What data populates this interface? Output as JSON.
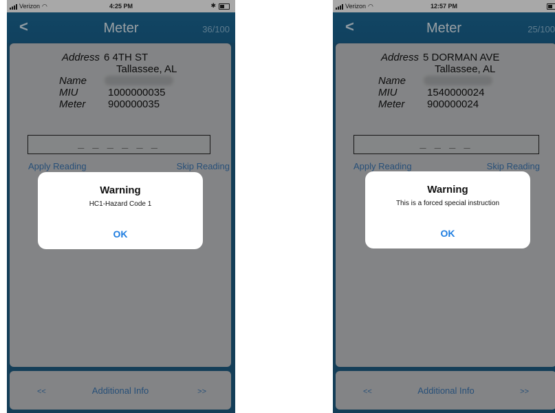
{
  "screens": [
    {
      "status": {
        "carrier": "Verizon",
        "time": "4:25 PM",
        "bluetooth": "✱"
      },
      "nav": {
        "back": "<",
        "title": "Meter",
        "counter": "36/100"
      },
      "fields": {
        "address_label": "Address",
        "address_line1": "6 4TH ST",
        "address_line2": "Tallassee, AL",
        "name_label": "Name",
        "miu_label": "MIU",
        "miu_value": "1000000035",
        "meter_label": "Meter",
        "meter_value": "900000035"
      },
      "reading_placeholder": "_ _ _ _ _ _",
      "actions": {
        "apply": "Apply Reading",
        "skip": "Skip Reading"
      },
      "dialog": {
        "title": "Warning",
        "message": "HC1-Hazard Code 1",
        "button": "OK"
      },
      "footer": {
        "prev": "<<",
        "info": "Additional Info",
        "next": ">>"
      }
    },
    {
      "status": {
        "carrier": "Verizon",
        "time": "12:57 PM"
      },
      "nav": {
        "back": "<",
        "title": "Meter",
        "counter": "25/100"
      },
      "fields": {
        "address_label": "Address",
        "address_line1": "5 DORMAN AVE",
        "address_line2": "Tallassee, AL",
        "name_label": "Name",
        "miu_label": "MIU",
        "miu_value": "1540000024",
        "meter_label": "Meter",
        "meter_value": "900000024"
      },
      "reading_placeholder": "_ _ _ _",
      "actions": {
        "apply": "Apply Reading",
        "skip": "Skip Reading"
      },
      "dialog": {
        "title": "Warning",
        "message": "This is a forced special instruction",
        "button": "OK"
      },
      "footer": {
        "prev": "<<",
        "info": "Additional Info",
        "next": ">>"
      }
    }
  ],
  "colors": {
    "nav": "#1c6b98",
    "card": "#c7c9cb",
    "link": "#3c78b6",
    "ok": "#1e7de0"
  }
}
